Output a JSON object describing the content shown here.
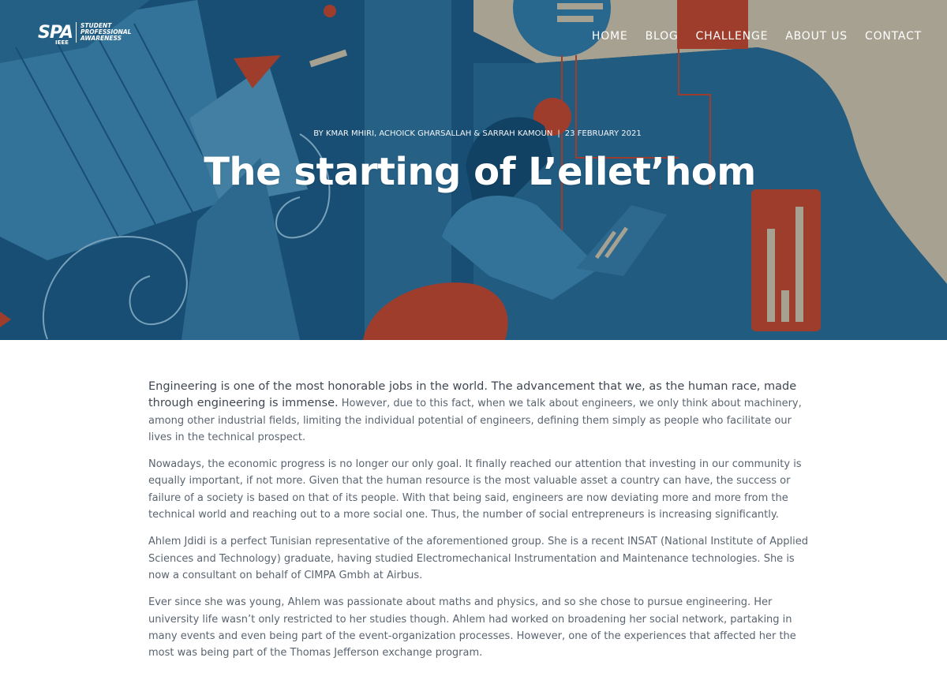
{
  "logo": {
    "mark": "SPA",
    "sub": "IEEE",
    "words": [
      "STUDENT",
      "PROFESSIONAL",
      "AWARENESS"
    ]
  },
  "nav": [
    "HOME",
    "BLOG",
    "CHALLENGE",
    "ABOUT US",
    "CONTACT"
  ],
  "post": {
    "byline": "BY KMAR MHIRI, ACHOICK GHARSALLAH & SARRAH KAMOUN",
    "separator": "|",
    "date": "23 FEBRUARY 2021",
    "title": "The starting of L’ellet’hom"
  },
  "article": {
    "lead": "Engineering is one of the most honorable jobs in the world. The advancement that we, as the human race, made through engineering is immense.",
    "p1_rest": " However, due to this fact, when we talk about engineers, we only think about machinery, among other industrial fields, limiting the individual potential of engineers, defining them simply as people who facilitate our lives in the technical prospect.",
    "p2": "Nowadays, the economic progress is no longer our only goal. It finally reached our attention that investing in our community is equally important, if not more. Given that the human resource is the most valuable asset a country can have, the success or failure of a society is based on that of its people. With that being said, engineers are now deviating more and more from the technical world and reaching out to a more social one. Thus, the number of social entrepreneurs is increasing significantly.",
    "p3": "Ahlem Jdidi is a perfect Tunisian representative of the aforementioned group. She is a recent INSAT (National Institute of Applied Sciences and Technology) graduate, having studied Electromechanical Instrumentation and Maintenance technologies. She is now a consultant on behalf of CIMPA Gmbh at Airbus.",
    "p4": "Ever since she was young, Ahlem was passionate about maths and physics, and so she chose to pursue engineering. Her university life wasn’t only restricted to her studies though. Ahlem had worked on broadening her social network, partaking in many events and even being part of the event-organization processes. However, one of the experiences that affected her the most was being part of the Thomas Jefferson exchange program."
  },
  "colors": {
    "hero_blue": "#1d5f86",
    "hero_beige": "#c9bfa6",
    "hero_red": "#c0452c",
    "body_text": "#5a6470"
  }
}
